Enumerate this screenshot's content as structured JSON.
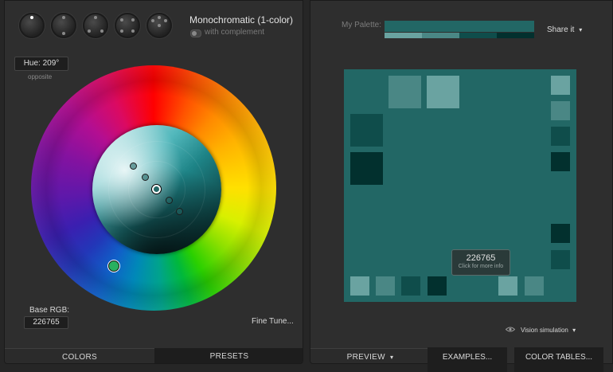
{
  "header": {
    "mode_title": "Monochromatic (1-color)",
    "complement_label": "with complement"
  },
  "left": {
    "hue_label": "Hue: 209°",
    "opposite_label": "opposite",
    "base_rgb_label": "Base RGB:",
    "base_rgb_value": "226765",
    "fine_tune_label": "Fine Tune..."
  },
  "tabs": {
    "colors": "COLORS",
    "presets": "PRESETS",
    "preview": "PREVIEW",
    "examples": "EXAMPLES...",
    "color_tables": "COLOR TABLES..."
  },
  "right": {
    "palette_label": "My Palette:",
    "share_label": "Share it",
    "tooltip_hex": "226765",
    "tooltip_sub": "Click for more info",
    "vision_label": "Vision simulation"
  },
  "colors": {
    "base": "#226765",
    "light2": "#6aa3a1",
    "light1": "#4a8785",
    "dark1": "#0f4d4b",
    "dark2": "#02302e",
    "panel": "#2e2e2e",
    "accent_text": "#d8d8d8"
  },
  "icons": {
    "caret": "▾"
  }
}
